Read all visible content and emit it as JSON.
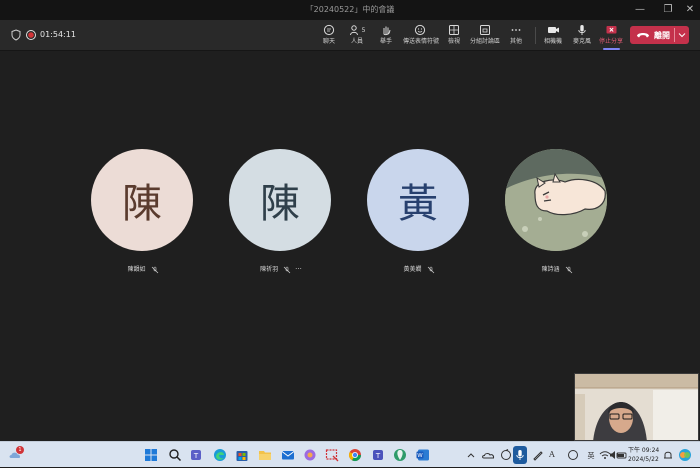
{
  "window": {
    "title": "「20240522」中的會議"
  },
  "meeting": {
    "timer": "01:54:11"
  },
  "toolbar": {
    "chat": "聊天",
    "people": "人員",
    "people_count": "5",
    "raise_hand": "舉手",
    "reactions": "傳送表情符號",
    "view": "檢視",
    "rooms": "分組討論區",
    "more": "其他",
    "camera": "相機機",
    "mic": "麥克風",
    "share": "停止分享",
    "leave": "離開"
  },
  "participants": [
    {
      "initial": "陳",
      "name": "陳韻如",
      "bg": "#ecdcd6",
      "fg": "#5a3b2e"
    },
    {
      "initial": "陳",
      "name": "陳祈羽",
      "bg": "#d4dde3",
      "fg": "#2f3f4a"
    },
    {
      "initial": "黃",
      "name": "黃美嫺",
      "bg": "#c9d6ec",
      "fg": "#27406e"
    },
    {
      "initial": "",
      "name": "陳詩涵",
      "bg": "#9aa58a",
      "fg": "#333333"
    }
  ],
  "more_options": "···",
  "taskbar": {
    "weather_badge": "1",
    "clock_period_time": "下午 09:24",
    "clock_date": "2024/5/22"
  },
  "colors": {
    "leave_red": "#c4314b",
    "accent": "#7f85f5",
    "stage_bg": "#1f1f1f"
  }
}
